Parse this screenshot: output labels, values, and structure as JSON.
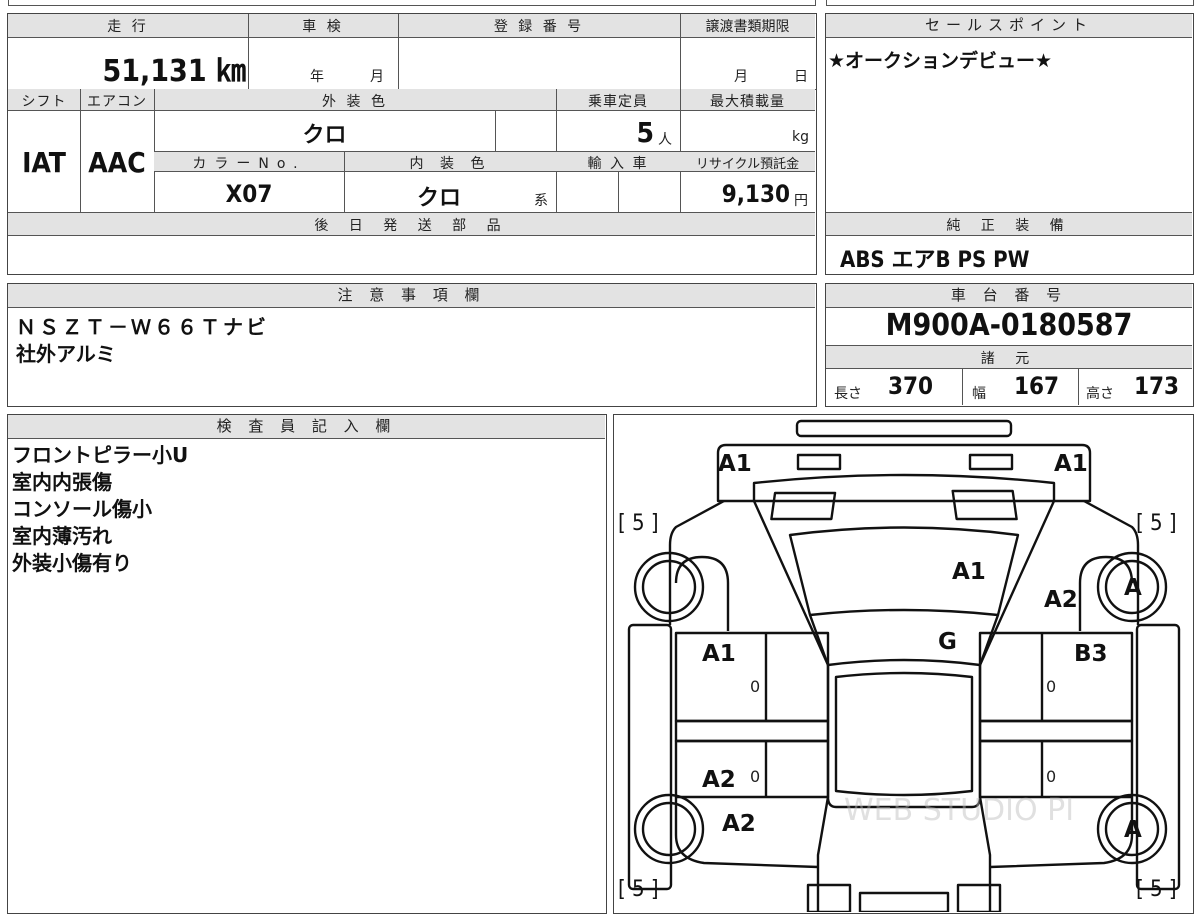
{
  "mileage": {
    "label": "走 行",
    "value": "51,131 ㎞"
  },
  "inspection": {
    "label": "車 検",
    "year_unit": "年",
    "month_unit": "月"
  },
  "registration": {
    "label": "登 録 番 号"
  },
  "transfer_deadline": {
    "label": "譲渡書類期限",
    "month_unit": "月",
    "day_unit": "日"
  },
  "sales_point": {
    "label": "セールスポイント",
    "text": "★オークションデビュー★"
  },
  "shift": {
    "label": "シフト",
    "value": "IAT"
  },
  "aircon": {
    "label": "エアコン",
    "value": "AAC"
  },
  "exterior_color": {
    "label": "外 装 色",
    "value": "クロ"
  },
  "capacity": {
    "label": "乗車定員",
    "value": "5",
    "unit": "人"
  },
  "max_load": {
    "label": "最大積載量",
    "unit": "kg"
  },
  "color_no": {
    "label": "カラーNo.",
    "value": "X07"
  },
  "interior_color": {
    "label": "内 装 色",
    "value": "クロ",
    "unit": "系"
  },
  "import": {
    "label": "輸 入 車"
  },
  "recycle": {
    "label": "リサイクル預託金",
    "value": "9,130",
    "unit": "円"
  },
  "later_parts": {
    "label": "後 日 発 送 部 品"
  },
  "equipment": {
    "label": "純 正 装 備",
    "value": "ABS エアB PS PW"
  },
  "notes": {
    "label": "注 意 事 項 欄",
    "lines": [
      "ＮＳＺＴ－Ｗ６６Ｔナビ",
      "社外アルミ"
    ]
  },
  "chassis": {
    "label": "車 台 番 号",
    "value": "M900A-0180587"
  },
  "specs": {
    "label": "諸 元",
    "length_label": "長さ",
    "length": "370",
    "width_label": "幅",
    "width": "167",
    "height_label": "高さ",
    "height": "173"
  },
  "inspector": {
    "label": "検 査 員 記 入 欄",
    "lines": [
      "フロントピラー小U",
      "室内内張傷",
      "コンソール傷小",
      "室内薄汚れ",
      "外装小傷有り"
    ]
  },
  "diagram": {
    "tire_depth_fl": "[ 5 ]",
    "tire_depth_fr": "[ 5 ]",
    "tire_depth_rl": "[ 5 ]",
    "tire_depth_rr": "[ 5 ]",
    "marks": {
      "front_left": "A1",
      "front_right": "A1",
      "windshield": "A1",
      "right_fender": "A2",
      "right_front_wheel": "A",
      "roof": "G",
      "left_front_door": "A1",
      "right_front_door": "B3",
      "left_rear_door": "A2",
      "left_rear_fender": "A2",
      "right_rear_wheel": "A",
      "zero_lf": "0",
      "zero_rf": "0",
      "zero_lr": "0",
      "zero_rr": "0"
    },
    "watermark": "WEB STUDIO PI"
  }
}
